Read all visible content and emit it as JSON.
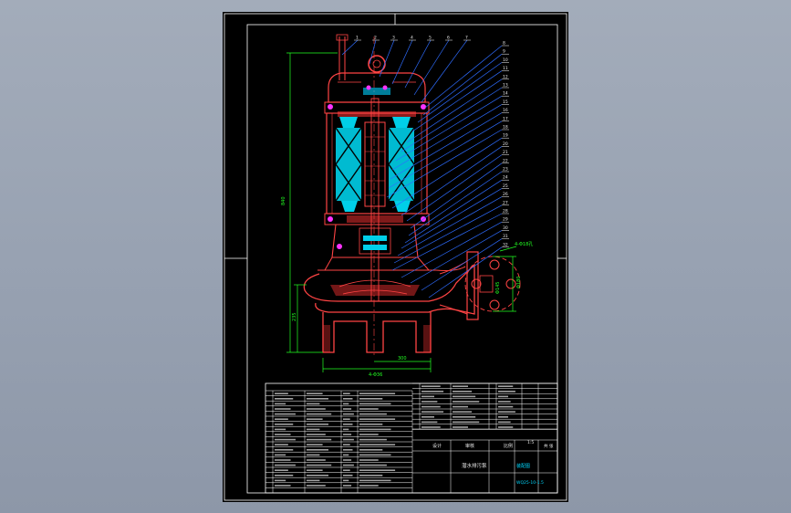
{
  "colors": {
    "background": "#98a2b2",
    "sheet": "#000000",
    "frame": "#ffffff",
    "pump_outline": "#ff3333",
    "dimension": "#33ff33",
    "leader": "#2e6cff",
    "parts": "#00e5ff",
    "accent": "#ff33ff",
    "text": "#e8e8e8"
  },
  "drawing": {
    "balloon_numbers": [
      "1",
      "2",
      "3",
      "4",
      "5",
      "6",
      "7",
      "8",
      "9",
      "10",
      "11",
      "12",
      "13",
      "14",
      "15",
      "16",
      "17",
      "18",
      "19",
      "20",
      "21",
      "22",
      "23",
      "24",
      "25",
      "26",
      "27",
      "28",
      "29",
      "30",
      "31",
      "32"
    ],
    "dimensions": {
      "overall_height": "840",
      "lower_height": "235",
      "base_width": "4-Φ36",
      "base_offset": "300",
      "flange_callout": "4-Φ18孔",
      "flange_bolt_circle": "Φ180",
      "flange_dia": "Φ145"
    }
  },
  "title_block": {
    "designer_label": "设计",
    "checker_label": "审核",
    "scale_label": "比例",
    "scale_value": "1:5",
    "sheet_label": "共 张",
    "drawing_title": "潜水排污泵",
    "company": "装配图",
    "drawing_number": "WQ25-10-1.5"
  }
}
